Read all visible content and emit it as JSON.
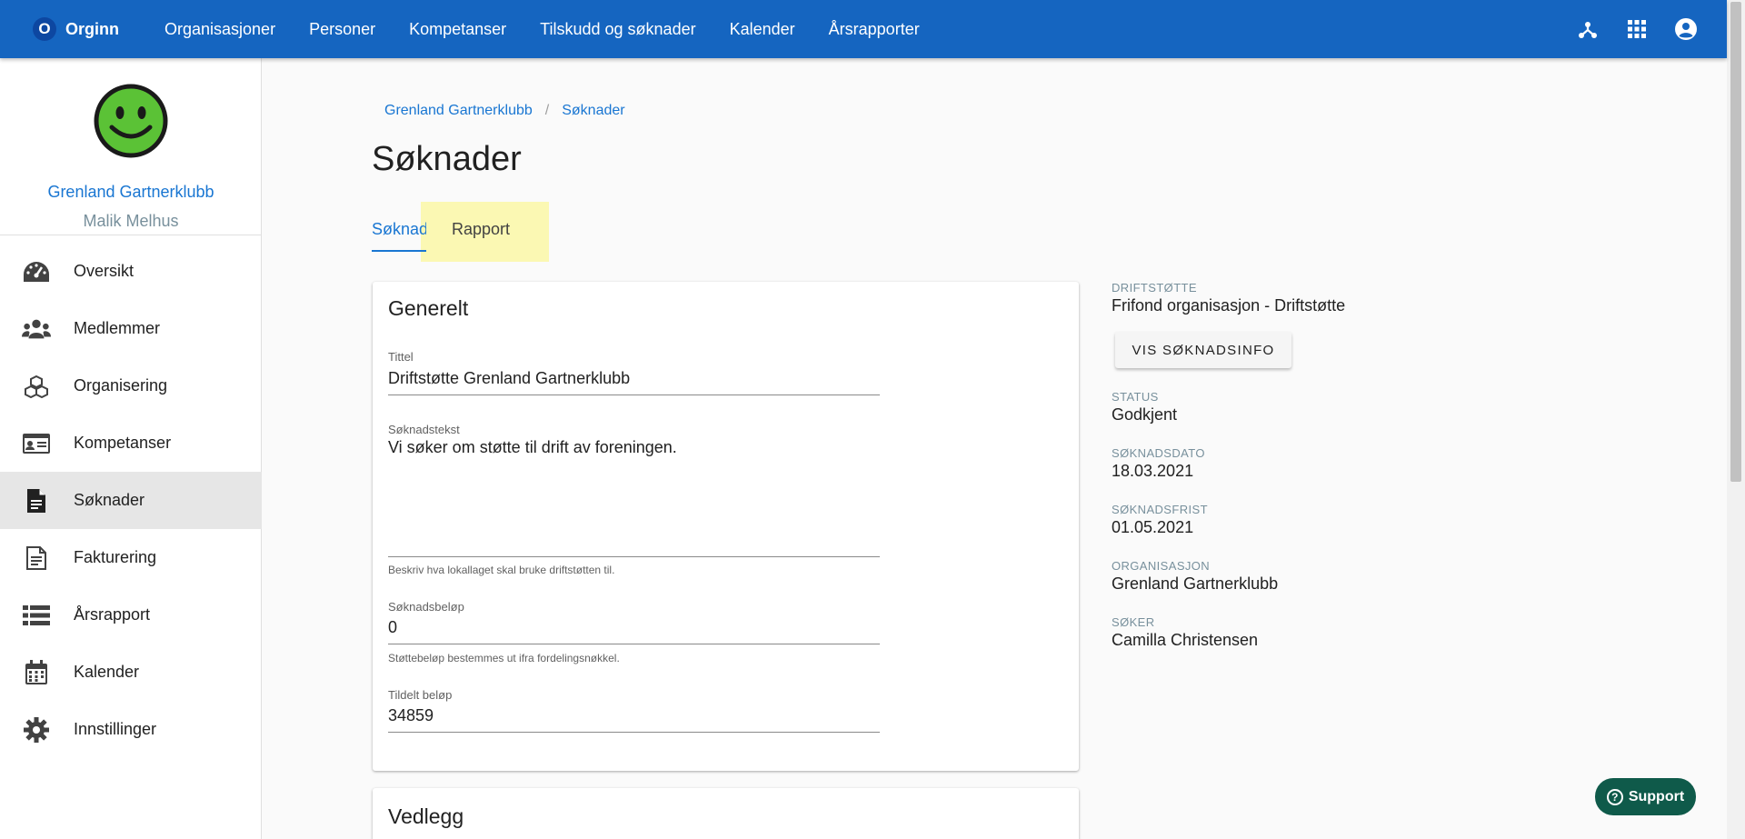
{
  "header": {
    "brand_initial": "O",
    "brand_name": "Orginn",
    "nav": [
      "Organisasjoner",
      "Personer",
      "Kompetanser",
      "Tilskudd og søknader",
      "Kalender",
      "Årsrapporter"
    ]
  },
  "sidebar": {
    "org_name": "Grenland Gartnerklubb",
    "user_name": "Malik Melhus",
    "items": [
      {
        "label": "Oversikt",
        "icon": "gauge-icon"
      },
      {
        "label": "Medlemmer",
        "icon": "people-icon"
      },
      {
        "label": "Organisering",
        "icon": "boxes-icon"
      },
      {
        "label": "Kompetanser",
        "icon": "id-card-icon"
      },
      {
        "label": "Søknader",
        "icon": "document-icon"
      },
      {
        "label": "Fakturering",
        "icon": "invoice-icon"
      },
      {
        "label": "Årsrapport",
        "icon": "list-icon"
      },
      {
        "label": "Kalender",
        "icon": "calendar-icon"
      },
      {
        "label": "Innstillinger",
        "icon": "gear-icon"
      }
    ],
    "active_item": "Søknader"
  },
  "breadcrumb": [
    "Grenland Gartnerklubb",
    "Søknader"
  ],
  "page": {
    "title": "Søknader",
    "tabs": [
      "Søknad",
      "Rapport"
    ]
  },
  "general": {
    "title": "Generelt",
    "tittel_label": "Tittel",
    "tittel_value": "Driftstøtte Grenland Gartnerklubb",
    "soknadstekst_label": "Søknadstekst",
    "soknadstekst_value": "Vi søker om støtte til drift av foreningen.",
    "soknadstekst_hint": "Beskriv hva lokallaget skal bruke driftstøtten til.",
    "belop_label": "Søknadsbeløp",
    "belop_value": "0",
    "belop_hint": "Støttebeløp bestemmes ut ifra fordelingsnøkkel.",
    "tildelt_label": "Tildelt beløp",
    "tildelt_value": "34859"
  },
  "vedlegg": {
    "title": "Vedlegg"
  },
  "info": {
    "driftstotte_label": "Driftstøtte",
    "driftstotte_value": "Frifond organisasjon - Driftstøtte",
    "button_label": "VIS SØKNADSINFO",
    "status_label": "Status",
    "status_value": "Godkjent",
    "soknadsdato_label": "Søknadsdato",
    "soknadsdato_value": "18.03.2021",
    "soknadsfrist_label": "Søknadsfrist",
    "soknadsfrist_value": "01.05.2021",
    "organisasjon_label": "Organisasjon",
    "organisasjon_value": "Grenland Gartnerklubb",
    "soker_label": "Søker",
    "soker_value": "Camilla Christensen"
  },
  "support": {
    "label": "Support"
  }
}
